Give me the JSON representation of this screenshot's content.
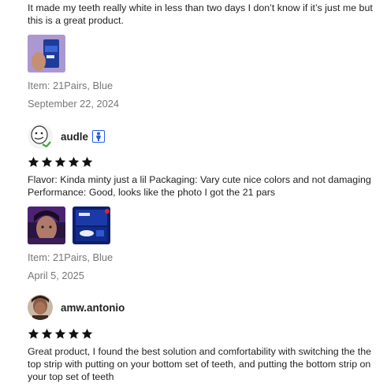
{
  "reviews": [
    {
      "text": "It made my teeth really white in less than two days I don’t know if it’s just me but this is a great product.",
      "item": "Item: 21Pairs, Blue",
      "date": "September 22, 2024"
    },
    {
      "username": "audle",
      "text": "Flavor: Kinda minty just a lil Packaging: Vary cute nice colors and not damaging Performance: Good, looks like the photo I got the 21 pars",
      "item": "Item: 21Pairs, Blue",
      "date": "April 5, 2025"
    },
    {
      "username": "amw.antonio",
      "text": "Great product, I found the best solution and comfortability with switching the the top strip with putting on your bottom set of teeth, and putting the bottom strip on your top set of teeth"
    }
  ],
  "rating": "5 stars",
  "icons": {
    "star": "star-icon",
    "verify": "person-badge-icon"
  },
  "colors": {
    "text": "#222222",
    "meta": "#777777",
    "badge": "#1f5ee6"
  }
}
